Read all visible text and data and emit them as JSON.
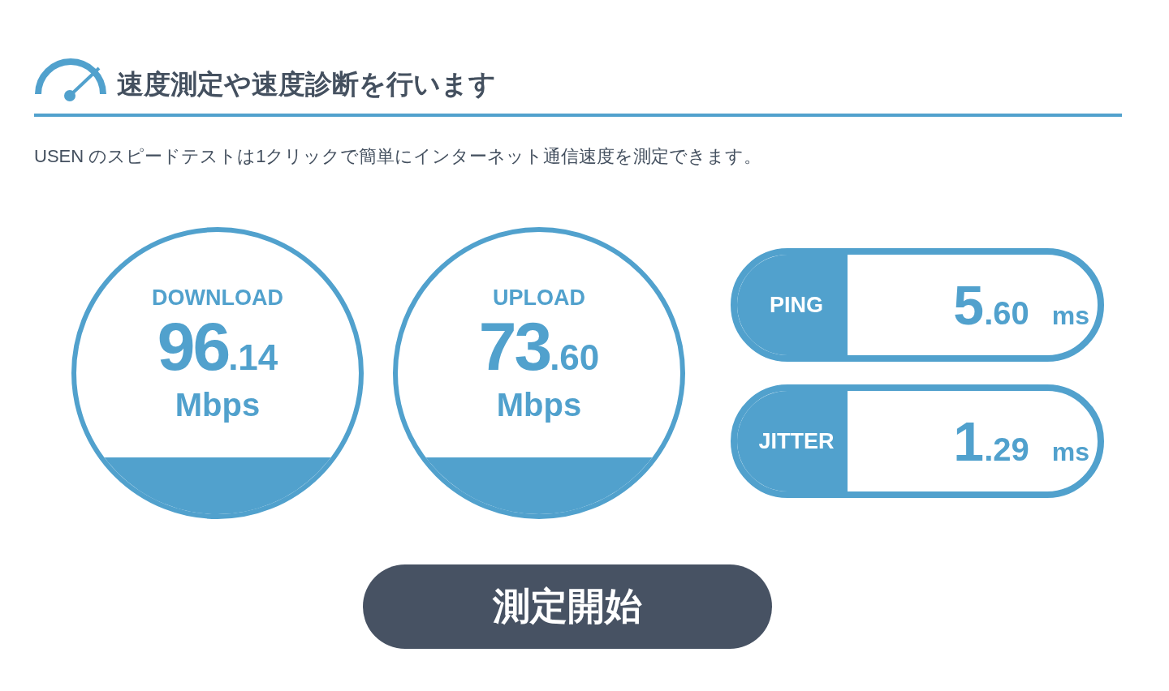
{
  "header": {
    "title": "速度測定や速度診断を行います"
  },
  "description": "USEN のスピードテストは1クリックで簡単にインターネット通信速度を測定できます。",
  "gauges": [
    {
      "label": "DOWNLOAD",
      "whole": "96",
      "fraction": ".14",
      "unit": "Mbps"
    },
    {
      "label": "UPLOAD",
      "whole": "73",
      "fraction": ".60",
      "unit": "Mbps"
    }
  ],
  "metrics": [
    {
      "label": "PING",
      "whole": "5",
      "fraction": ".60",
      "unit": "ms"
    },
    {
      "label": "JITTER",
      "whole": "1",
      "fraction": ".29",
      "unit": "ms"
    }
  ],
  "start_button": "測定開始"
}
